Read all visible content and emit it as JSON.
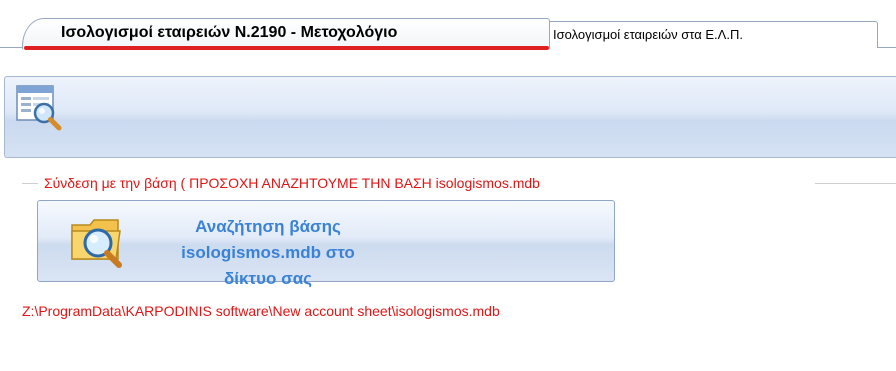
{
  "tabs": [
    {
      "label": "Ισολογισμοί εταιρειών Ν.2190 - Μετοχολόγιο",
      "active": true
    },
    {
      "label": "Ισολογισμοί εταιρειών στα Ε.Λ.Π.",
      "active": false
    }
  ],
  "toolbar": {
    "icons": [
      "search-form-icon"
    ]
  },
  "connection": {
    "legend": "Σύνδεση με την βάση ( ΠΡΟΣΟΧΗ ΑΝΑΖΗΤΟΥΜΕ ΤΗΝ ΒΑΣΗ isologismos.mdb",
    "search_button_line1": "Αναζήτηση βάσης isologismos.mdb στο",
    "search_button_line2": "δίκτυο σας",
    "db_path": "Z:\\ProgramData\\KARPODINIS software\\New account sheet\\isologismos.mdb"
  },
  "colors": {
    "accent_red": "#e31414",
    "button_text_blue": "#3a82d6",
    "toolbar_blue": "#dde8f7"
  }
}
